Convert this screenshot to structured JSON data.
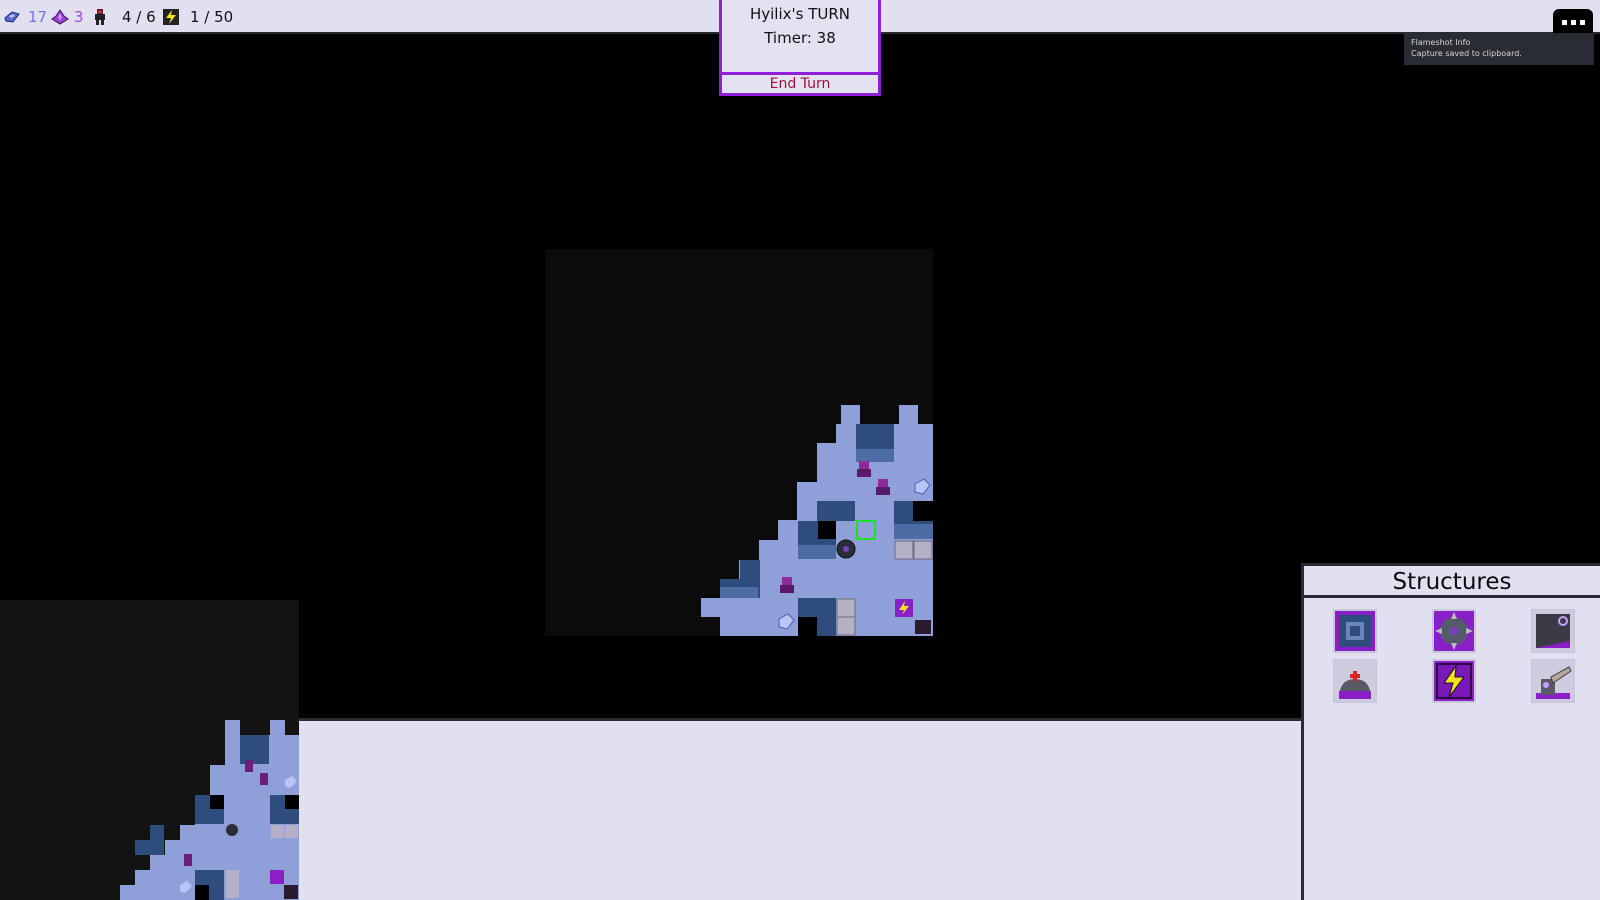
{
  "resources": {
    "crystals": "17",
    "gems": "3",
    "units": "4 / 6",
    "energy": "1 / 50",
    "colors": {
      "crystal": "#6e78e0",
      "gem": "#a24ad6",
      "text": "#111111"
    }
  },
  "turn": {
    "title": "Hyilix's TURN",
    "timer": "Timer: 38",
    "end_turn_label": "End Turn"
  },
  "notification": {
    "title": "Flameshot Info",
    "body": "Capture saved to clipboard."
  },
  "structures": {
    "title": "Structures",
    "items": [
      {
        "name": "wall"
      },
      {
        "name": "turret"
      },
      {
        "name": "portal"
      },
      {
        "name": "medbay"
      },
      {
        "name": "generator"
      },
      {
        "name": "drill"
      }
    ]
  },
  "colors": {
    "accent": "#8f1fd8",
    "end_turn_text": "#a10f3a",
    "panel_bg": "#e1e0f1",
    "terrain": "#8fa0d8",
    "rock": "#2f4d7c"
  }
}
